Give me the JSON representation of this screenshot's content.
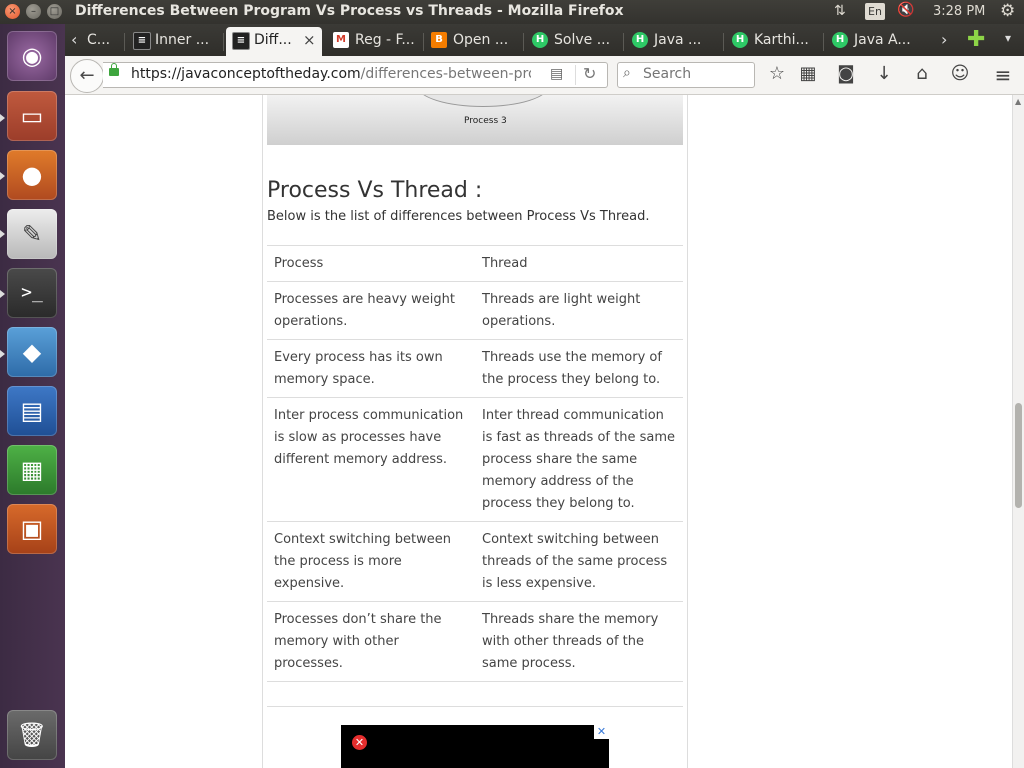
{
  "window": {
    "title": "Differences Between Program Vs Process vs Threads - Mozilla Firefox",
    "close_glyph": "×",
    "minimize_glyph": "–",
    "maximize_glyph": "□"
  },
  "indicators": {
    "network_glyph": "⇅",
    "keyboard_layout": "En",
    "volume_glyph": "🔇",
    "clock": "3:28 PM",
    "settings_glyph": "⚙"
  },
  "launcher": {
    "items": [
      {
        "name": "ubuntu-dash",
        "glyph": "◉"
      },
      {
        "name": "files",
        "glyph": "▭"
      },
      {
        "name": "firefox",
        "glyph": "●"
      },
      {
        "name": "text-editor",
        "glyph": "✎"
      },
      {
        "name": "terminal",
        "glyph": ">_"
      },
      {
        "name": "virtualbox",
        "glyph": "◆"
      },
      {
        "name": "libreoffice-writer",
        "glyph": "▤"
      },
      {
        "name": "libreoffice-calc",
        "glyph": "▦"
      },
      {
        "name": "libreoffice-impress",
        "glyph": "▣"
      },
      {
        "name": "trash",
        "glyph": "🗑"
      }
    ]
  },
  "tabs": [
    {
      "label": "C...",
      "icon": "cut-tab-icon",
      "favicon": ""
    },
    {
      "label": "Inner ...",
      "icon": "document-icon",
      "favicon": "≡"
    },
    {
      "label": "Diff...",
      "icon": "document-icon",
      "favicon": "≡",
      "active": true,
      "close_glyph": "×"
    },
    {
      "label": "Reg - F...",
      "icon": "gmail-icon",
      "favicon": "M"
    },
    {
      "label": "Open ...",
      "icon": "blogger-icon",
      "favicon": "B"
    },
    {
      "label": "Solve ...",
      "icon": "hackerrank-icon",
      "favicon": "H"
    },
    {
      "label": "Java ...",
      "icon": "hackerrank-icon",
      "favicon": "H"
    },
    {
      "label": "Karthi...",
      "icon": "hackerrank-icon",
      "favicon": "H"
    },
    {
      "label": "Java A...",
      "icon": "hackerrank-icon",
      "favicon": "H"
    }
  ],
  "tabbar": {
    "scroll_left_glyph": "‹",
    "scroll_right_glyph": "›",
    "new_tab_glyph": "✚",
    "list_glyph": "▾"
  },
  "navbar": {
    "back_glyph": "←",
    "url_host": "https://javaconceptoftheday.com",
    "url_path": "/differences-between-pro",
    "reader_glyph": "▤",
    "reload_glyph": "↻",
    "search_glyph": "⌕",
    "search_placeholder": "Search",
    "bookmark_glyph": "☆",
    "library_glyph": "▦",
    "pocket_glyph": "◙",
    "download_glyph": "↓",
    "home_glyph": "⌂",
    "hello_glyph": "☺",
    "menu_glyph": "≡"
  },
  "page": {
    "diagram_label": "Process 3",
    "heading": "Process Vs Thread :",
    "intro": "Below is the list of differences between Process Vs Thread.",
    "table": {
      "headers": [
        "Process",
        "Thread"
      ],
      "rows": [
        [
          "Processes are heavy weight operations.",
          "Threads are light weight operations."
        ],
        [
          "Every process has its own memory space.",
          "Threads use the memory of the process they belong to."
        ],
        [
          "Inter process communication is slow as processes have different memory address.",
          "Inter thread communication is fast as threads of the same process share the same memory address of the process they belong to."
        ],
        [
          "Context switching between the process is more expensive.",
          "Context switching between threads of the same process is less expensive."
        ],
        [
          "Processes don’t share the memory with other processes.",
          "Threads share the memory with other threads of the same process."
        ]
      ]
    },
    "ad": {
      "close_glyph": "✕",
      "dismiss_glyph": "✕"
    }
  },
  "scrollbar": {
    "position_fraction": 0.53,
    "visible_fraction": 0.16,
    "up_glyph": "▲"
  }
}
